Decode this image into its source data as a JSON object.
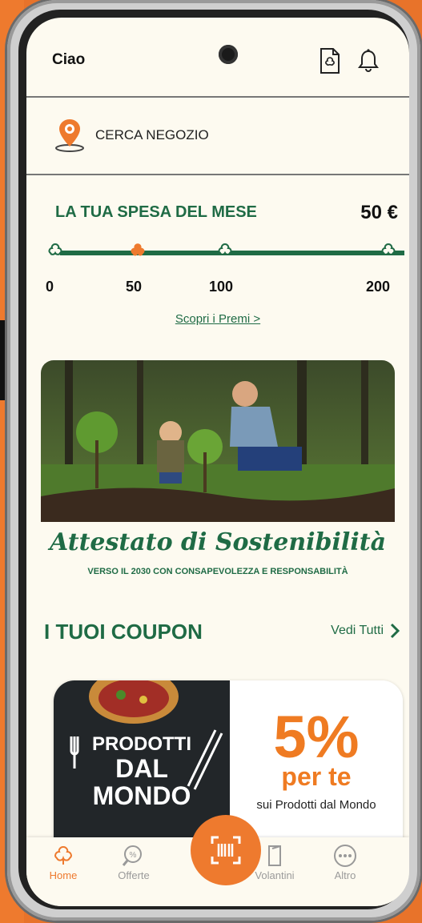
{
  "header": {
    "greeting": "Ciao"
  },
  "store": {
    "label": "CERCA NEGOZIO"
  },
  "spending": {
    "title": "LA TUA SPESA DEL MESE",
    "amount": "50 €",
    "ticks": [
      "0",
      "50",
      "100",
      "200"
    ],
    "current_value": 50,
    "max_value": 200,
    "rewards_link": "Scopri i Premi >"
  },
  "banner": {
    "title": "Attestato di Sostenibilità",
    "subtitle": "VERSO IL 2030 CON CONSAPEVOLEZZA E RESPONSABILITÀ"
  },
  "coupons": {
    "title": "I TUOI COUPON",
    "see_all": "Vedi Tutti",
    "card": {
      "left_line1": "PRODOTTI",
      "left_line2": "DAL",
      "left_line3": "MONDO",
      "percent": "5%",
      "per_te": "per te",
      "description": "sui Prodotti dal Mondo"
    }
  },
  "tabbar": {
    "items": [
      {
        "label": "Home",
        "icon": "clover-icon",
        "active": true
      },
      {
        "label": "Offerte",
        "icon": "discount-search-icon",
        "active": false
      },
      {
        "label": "",
        "icon": "barcode-scan-icon",
        "active": false
      },
      {
        "label": "Volantini",
        "icon": "flyer-icon",
        "active": false
      },
      {
        "label": "Altro",
        "icon": "more-dots-icon",
        "active": false
      }
    ]
  },
  "colors": {
    "brand_orange": "#ee7a2e",
    "brand_green": "#1f6b45",
    "background": "#fdfaf0"
  }
}
